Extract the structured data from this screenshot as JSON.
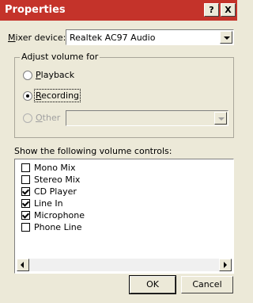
{
  "window": {
    "title": "Properties",
    "help_label": "?",
    "close_label": "X"
  },
  "mixer": {
    "label_prefix": "M",
    "label_rest": "ixer device:",
    "value": "Realtek AC97 Audio"
  },
  "adjust": {
    "legend": "Adjust volume for",
    "options": [
      {
        "underline": "P",
        "rest": "layback",
        "selected": false,
        "enabled": true
      },
      {
        "underline": "R",
        "rest": "ecording",
        "selected": true,
        "enabled": true
      },
      {
        "underline": "O",
        "rest": "ther",
        "selected": false,
        "enabled": false
      }
    ],
    "other_value": ""
  },
  "controls": {
    "heading": "Show the following volume controls:",
    "items": [
      {
        "label": "Mono Mix",
        "checked": false
      },
      {
        "label": "Stereo Mix",
        "checked": false
      },
      {
        "label": "CD Player",
        "checked": true
      },
      {
        "label": "Line In",
        "checked": true
      },
      {
        "label": "Microphone",
        "checked": true
      },
      {
        "label": "Phone Line",
        "checked": false
      }
    ]
  },
  "buttons": {
    "ok": "OK",
    "cancel": "Cancel"
  }
}
